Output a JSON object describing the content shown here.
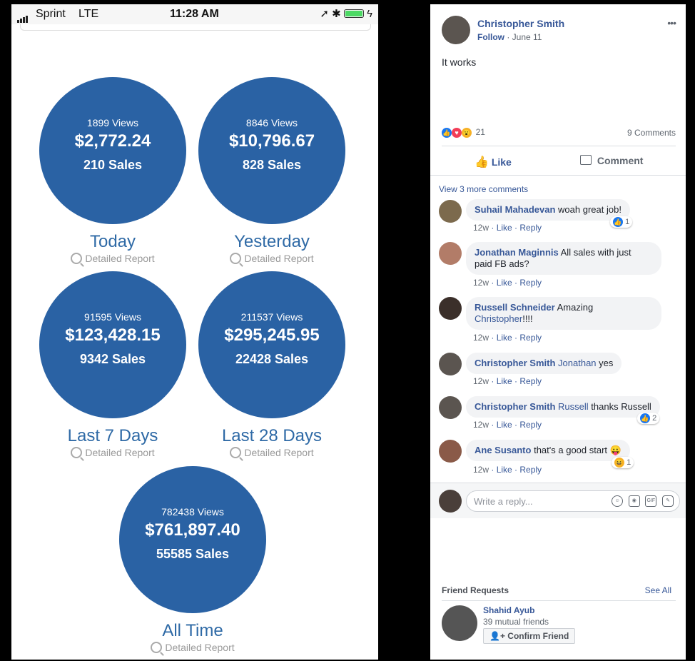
{
  "status_bar": {
    "carrier": "Sprint",
    "network": "LTE",
    "time": "11:28 AM"
  },
  "stats": [
    {
      "views": "1899 Views",
      "amount": "$2,772.24",
      "sales": "210 Sales",
      "period": "Today",
      "report": "Detailed Report"
    },
    {
      "views": "8846 Views",
      "amount": "$10,796.67",
      "sales": "828 Sales",
      "period": "Yesterday",
      "report": "Detailed Report"
    },
    {
      "views": "91595 Views",
      "amount": "$123,428.15",
      "sales": "9342 Sales",
      "period": "Last 7 Days",
      "report": "Detailed Report"
    },
    {
      "views": "211537 Views",
      "amount": "$295,245.95",
      "sales": "22428 Sales",
      "period": "Last 28 Days",
      "report": "Detailed Report"
    },
    {
      "views": "782438 Views",
      "amount": "$761,897.40",
      "sales": "55585 Sales",
      "period": "All Time",
      "report": "Detailed Report"
    }
  ],
  "post": {
    "author": "Christopher Smith",
    "follow": "Follow",
    "date": "June 11",
    "more": "•••",
    "text": "It works",
    "reaction_count": "21",
    "comments_count": "9 Comments",
    "like_action": "Like",
    "comment_action": "Comment",
    "view_more": "View 3 more comments"
  },
  "comments": [
    {
      "author": "Suhail Mahadevan",
      "text": "woah great job!",
      "age": "12w",
      "like": "Like",
      "reply": "Reply",
      "reactions": "1"
    },
    {
      "author": "Jonathan Maginnis",
      "text": "All sales with just",
      "text2": "paid FB ads?",
      "age": "12w",
      "like": "Like",
      "reply": "Reply"
    },
    {
      "author": "Russell Schneider",
      "text": "Amazing",
      "mention": "Christopher",
      "text2": "!!!!",
      "age": "12w",
      "like": "Like",
      "reply": "Reply"
    },
    {
      "author": "Christopher Smith",
      "mention": "Jonathan",
      "text": "yes",
      "age": "12w",
      "like": "Like",
      "reply": "Reply"
    },
    {
      "author": "Christopher Smith",
      "mention": "Russell",
      "text": "thanks Russell",
      "age": "12w",
      "like": "Like",
      "reply": "Reply",
      "reactions": "2"
    },
    {
      "author": "Ane Susanto",
      "text": "that's a good start",
      "emoji": "😛",
      "age": "12w",
      "like": "Like",
      "reply": "Reply",
      "reactions": "1"
    }
  ],
  "reply_box": {
    "placeholder": "Write a reply...",
    "gif": "GIF"
  },
  "friend_requests": {
    "title": "Friend Requests",
    "see_all": "See All",
    "name": "Shahid Ayub",
    "mutual": "39 mutual friends",
    "confirm": "Confirm Friend"
  },
  "colors": {
    "circle": "#2a62a4",
    "period_text": "#2f6aa6",
    "fb_link": "#385898",
    "fb_blue": "#1877f2"
  }
}
